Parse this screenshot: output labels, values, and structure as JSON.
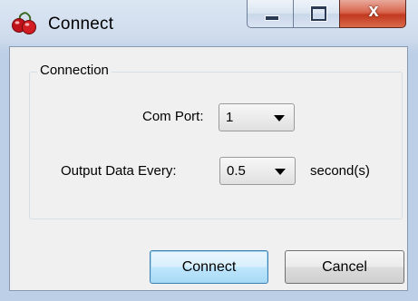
{
  "window": {
    "title": "Connect",
    "icon": "red-cherries-app-icon",
    "caption_buttons": [
      "minimize-icon",
      "maximize-icon",
      "close-icon"
    ],
    "close_glyph": "x"
  },
  "group": {
    "title": "Connection"
  },
  "com_port": {
    "label": "Com Port:",
    "value": "1"
  },
  "output_interval": {
    "label": "Output Data Every:",
    "value": "0.5",
    "suffix": "second(s)"
  },
  "buttons": {
    "connect": "Connect",
    "cancel": "Cancel"
  },
  "colors": {
    "close_button": "#c2391f",
    "default_button_border": "#3c7fb1",
    "client_background": "#f0f0f0"
  }
}
